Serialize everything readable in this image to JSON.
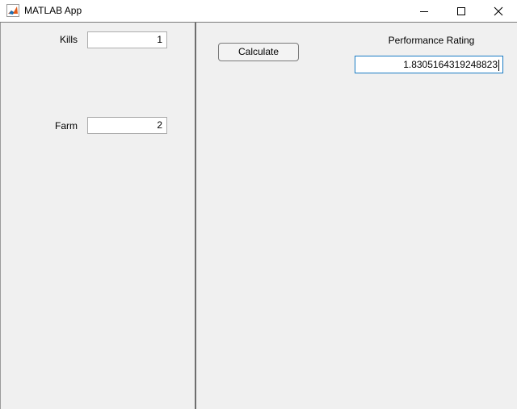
{
  "window": {
    "title": "MATLAB App",
    "icon": "matlab-membrane-icon",
    "controls": [
      "minimize-icon",
      "maximize-icon",
      "close-icon"
    ]
  },
  "left_panel": {
    "kills_label": "Kills",
    "kills_value": "1",
    "farm_label": "Farm",
    "farm_value": "2"
  },
  "right_panel": {
    "calculate_label": "Calculate",
    "rating_label": "Performance Rating",
    "rating_value": "1.8305164319248823"
  },
  "colors": {
    "panel_background": "#f0f0f0",
    "focus_border": "#1a7cc4"
  }
}
